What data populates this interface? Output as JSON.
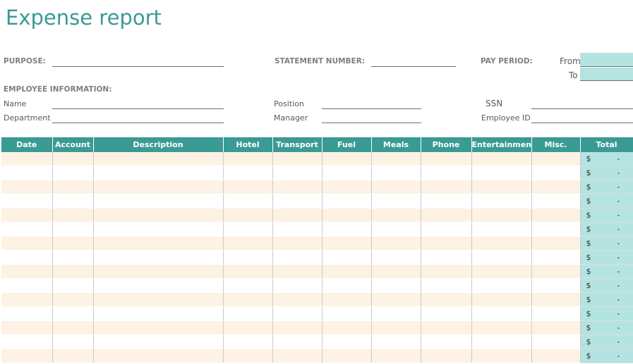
{
  "title": "Expense report",
  "labels": {
    "purpose": "PURPOSE:",
    "statement_number": "STATEMENT NUMBER:",
    "pay_period": "PAY PERIOD:",
    "from": "From",
    "to": "To",
    "employee_information": "EMPLOYEE INFORMATION:",
    "name": "Name",
    "position": "Position",
    "ssn": "SSN",
    "department": "Department",
    "manager": "Manager",
    "employee_id": "Employee ID"
  },
  "table": {
    "columns": [
      "Date",
      "Account",
      "Description",
      "Hotel",
      "Transport",
      "Fuel",
      "Meals",
      "Phone",
      "Entertainment",
      "Misc.",
      "Total"
    ],
    "currency_symbol": "$",
    "empty_total": "-",
    "row_count": 15
  },
  "colors": {
    "accent": "#3a9a94",
    "total_fill": "#b4e4e1",
    "stripe": "#fdf2e3"
  }
}
